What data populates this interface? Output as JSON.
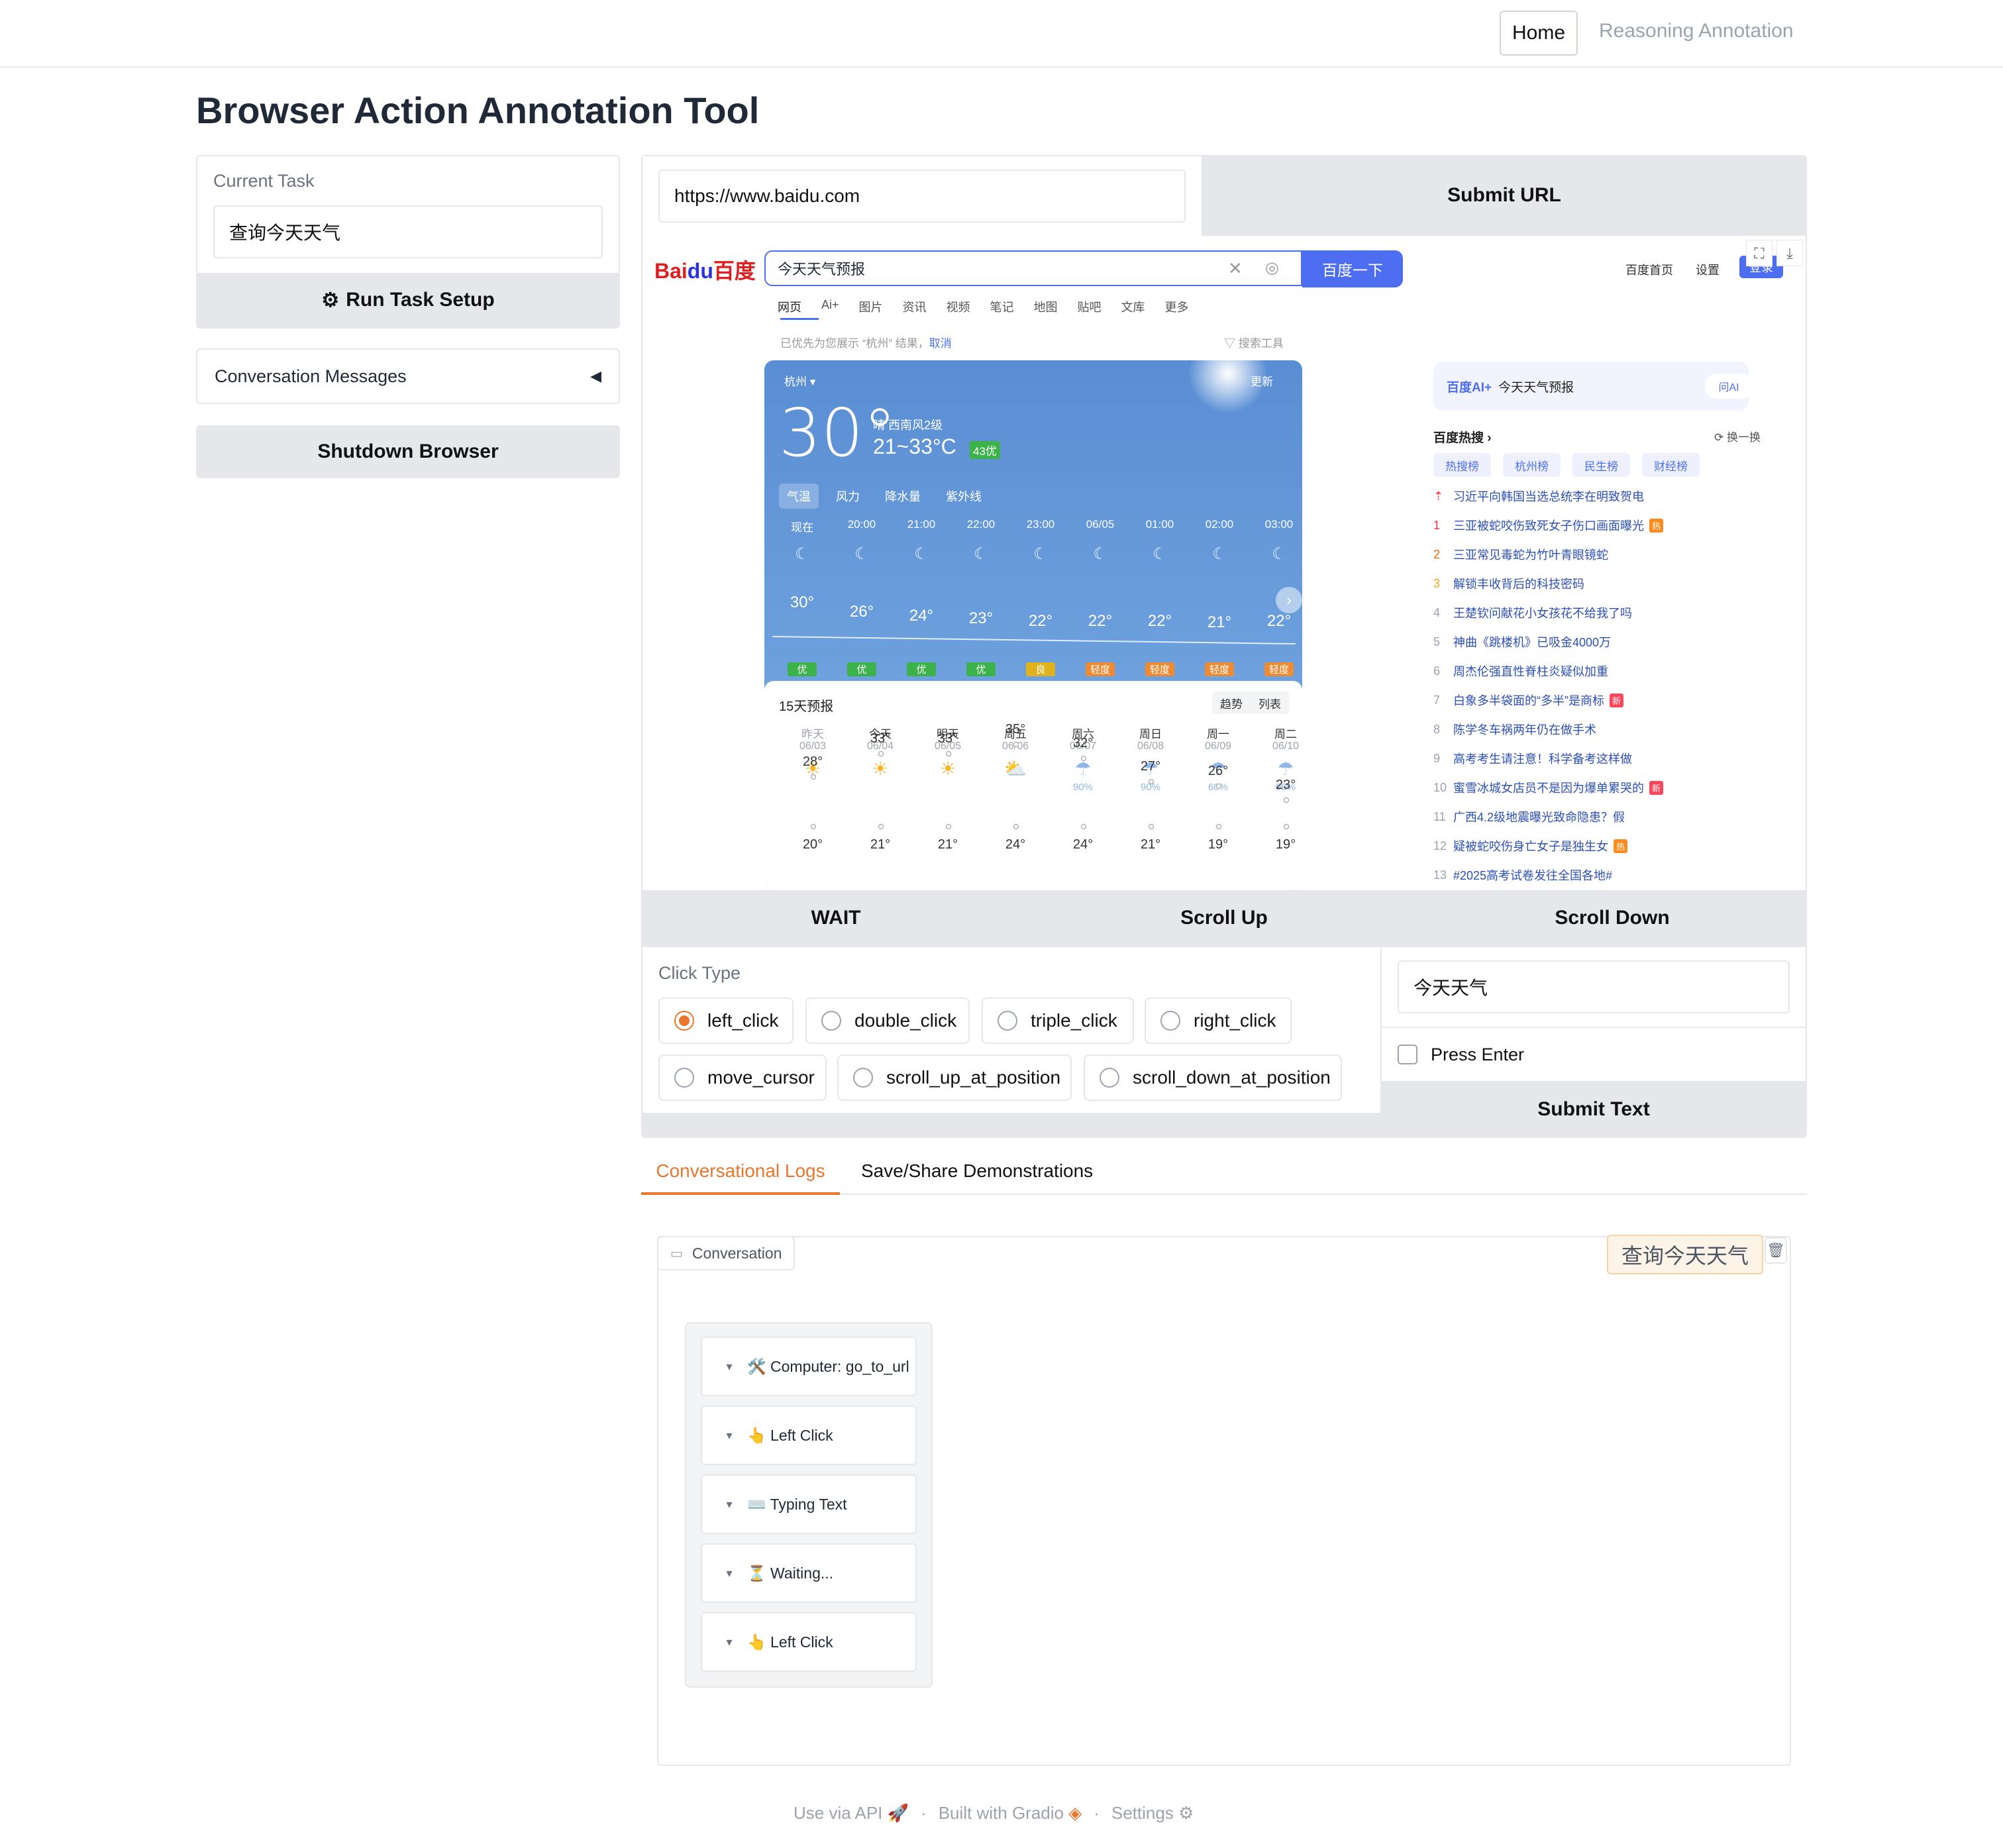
{
  "nav": {
    "home": "Home",
    "reasoning": "Reasoning Annotation"
  },
  "page_title": "Browser Action Annotation Tool",
  "left": {
    "task_label": "Current Task",
    "task_value": "查询今天天气",
    "run_setup": "Run Task Setup",
    "conversation_messages": "Conversation Messages",
    "shutdown": "Shutdown Browser"
  },
  "url_bar": {
    "value": "https://www.baidu.com",
    "submit": "Submit URL"
  },
  "screenshot": {
    "logo": "Bai百度",
    "search_value": "今天天气预报",
    "search_button": "百度一下",
    "top_links": [
      "百度首页",
      "设置",
      "登录"
    ],
    "tabs": [
      "网页",
      "Ai+",
      "图片",
      "资讯",
      "视频",
      "笔记",
      "地图",
      "贴吧",
      "文库",
      "更多"
    ],
    "notice": "已优先为您展示 “杭州” 结果，",
    "notice_cancel": "取消",
    "search_tools": "搜索工具",
    "weather": {
      "city": "杭州",
      "update": "更新",
      "temp": "30°",
      "desc": "晴  西南风2级",
      "range": "21~33°C",
      "aqi": "43优",
      "metric_tabs": [
        "气温",
        "风力",
        "降水量",
        "紫外线"
      ],
      "hours": [
        "现在",
        "20:00",
        "21:00",
        "22:00",
        "23:00",
        "06/05",
        "01:00",
        "02:00",
        "03:00"
      ],
      "hour_temps": [
        "30°",
        "26°",
        "24°",
        "23°",
        "22°",
        "22°",
        "22°",
        "21°",
        "22°"
      ],
      "hour_aqi": [
        "优",
        "优",
        "优",
        "优",
        "良",
        "轻度",
        "轻度",
        "轻度",
        "轻度"
      ],
      "forecast_title": "15天预报",
      "forecast_switch": [
        "趋势",
        "列表"
      ],
      "days": [
        "昨天",
        "今天",
        "明天",
        "周五",
        "周六",
        "周日",
        "周一",
        "周二"
      ],
      "dates": [
        "06/03",
        "06/04",
        "06/05",
        "06/06",
        "06/07",
        "06/08",
        "06/09",
        "06/10"
      ],
      "rain": [
        "",
        "",
        "",
        "",
        "90%",
        "90%",
        "60%",
        "90%"
      ],
      "highs": [
        "28°",
        "33°",
        "33°",
        "35°",
        "32°",
        "27°",
        "26°",
        "23°"
      ],
      "lows": [
        "20°",
        "21°",
        "21°",
        "24°",
        "24°",
        "21°",
        "19°",
        "19°"
      ]
    },
    "ai_box": {
      "title": "今天天气预报",
      "ask": "问AI"
    },
    "hot": {
      "title": "百度热搜",
      "refresh": "换一换",
      "tabs": [
        "热搜榜",
        "杭州榜",
        "民生榜",
        "财经榜"
      ],
      "items": [
        {
          "n": "",
          "t": "习近平向韩国当选总统李在明致贺电",
          "b": ""
        },
        {
          "n": "1",
          "t": "三亚被蛇咬伤致死女子伤口画面曝光",
          "b": "热"
        },
        {
          "n": "2",
          "t": "三亚常见毒蛇为竹叶青眼镜蛇",
          "b": ""
        },
        {
          "n": "3",
          "t": "解锁丰收背后的科技密码",
          "b": ""
        },
        {
          "n": "4",
          "t": "王楚钦问献花小女孩花不给我了吗",
          "b": ""
        },
        {
          "n": "5",
          "t": "神曲《跳楼机》已吸金4000万",
          "b": ""
        },
        {
          "n": "6",
          "t": "周杰伦强直性脊柱炎疑似加重",
          "b": ""
        },
        {
          "n": "7",
          "t": "白象多半袋面的“多半”是商标",
          "b": "新"
        },
        {
          "n": "8",
          "t": "陈学冬车祸两年仍在做手术",
          "b": ""
        },
        {
          "n": "9",
          "t": "高考考生请注意！科学备考这样做",
          "b": ""
        },
        {
          "n": "10",
          "t": "蜜雪冰城女店员不是因为爆单累哭的",
          "b": "新"
        },
        {
          "n": "11",
          "t": "广西4.2级地震曝光致命隐患？假",
          "b": ""
        },
        {
          "n": "12",
          "t": "疑被蛇咬伤身亡女子是独生女",
          "b": "热"
        },
        {
          "n": "13",
          "t": "#2025高考试卷发往全国各地#",
          "b": ""
        }
      ]
    }
  },
  "actions": {
    "wait": "WAIT",
    "scroll_up": "Scroll Up",
    "scroll_down": "Scroll Down"
  },
  "click_type": {
    "label": "Click Type",
    "options": [
      "left_click",
      "double_click",
      "triple_click",
      "right_click",
      "move_cursor",
      "scroll_up_at_position",
      "scroll_down_at_position"
    ],
    "selected": "left_click"
  },
  "text_input": {
    "value": "今天天气",
    "press_enter": "Press Enter",
    "submit": "Submit Text"
  },
  "tabs": [
    "Conversational Logs",
    "Save/Share Demonstrations"
  ],
  "conversation": {
    "label": "Conversation",
    "user_message": "查询今天天气",
    "messages": [
      "🛠️ Computer: go_to_url",
      "👆 Left Click",
      "⌨️ Typing Text",
      "⏳ Waiting...",
      "👆 Left Click"
    ]
  },
  "footer": {
    "api": "Use via API",
    "built": "Built with Gradio",
    "settings": "Settings"
  },
  "colors": {
    "accent": "#e8772e",
    "baidu_blue": "#4e6ef2",
    "sky": "#5b8fd3"
  }
}
